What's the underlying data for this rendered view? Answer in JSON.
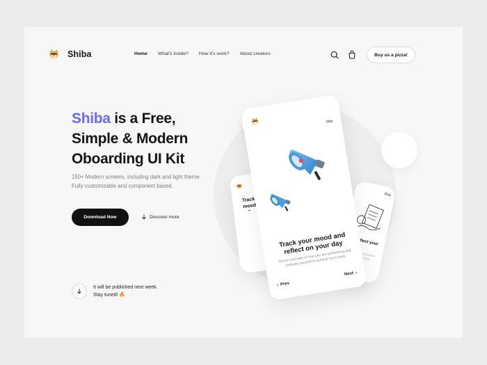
{
  "brand": {
    "name": "Shiba",
    "logo_icon": "shiba-dog-icon"
  },
  "nav": {
    "items": [
      {
        "label": "Home",
        "active": true
      },
      {
        "label": "What's inside?",
        "active": false
      },
      {
        "label": "How it's work?",
        "active": false
      },
      {
        "label": "About creators",
        "active": false
      }
    ],
    "search_icon": "search-icon",
    "bag_icon": "shopping-bag-icon",
    "cta_label": "Buy us a pizza!"
  },
  "hero": {
    "headline_brand": "Shiba",
    "headline_rest_1": " is a Free,",
    "headline_line_2": "Simple & Modern",
    "headline_line_3": "Oboarding UI Kit",
    "subtext": "150+ Modern screens, including dark and light theme. Fully customizable and component based.",
    "download_label": "Download Now",
    "discover_label": "Discover more",
    "notice_line_1": "It will be published next week.",
    "notice_line_2": "Stay tuned! 🔥"
  },
  "showcase": {
    "main_phone": {
      "skip_label": "Skip",
      "title": "Track your mood and reflect on your day",
      "description": "Get an overview of how you are performing and motivate yourself to achieve even more",
      "prev_label": "Prev",
      "next_label": "Next"
    },
    "left_phone": {
      "title": "Track your mood and reflect"
    },
    "right_phone": {
      "skip_label": "Skip",
      "title": "and reflect your day"
    }
  },
  "colors": {
    "accent": "#6a6cf0",
    "dark": "#111111",
    "card_bg": "#f7f7f7",
    "page_bg": "#ececec"
  }
}
